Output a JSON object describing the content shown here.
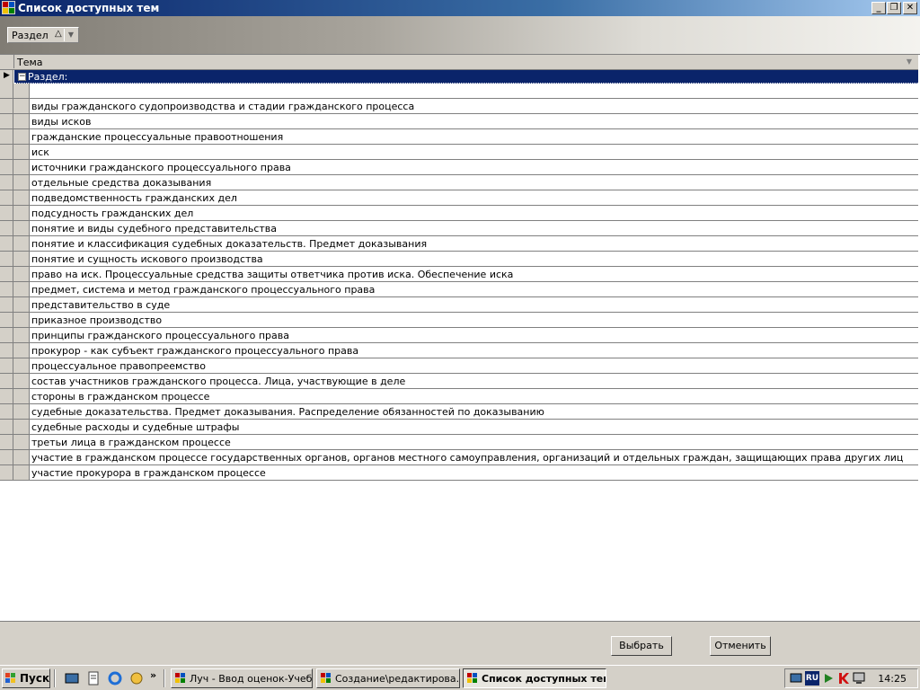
{
  "window": {
    "title": "Список доступных тем",
    "buttons": {
      "minimize": "_",
      "restore": "❐",
      "close": "✕"
    }
  },
  "group_panel": {
    "chip_label": "Раздел",
    "sort_glyph": "△",
    "dropdown_glyph": "▼"
  },
  "grid": {
    "column_header": "Тема",
    "column_dropdown_glyph": "▼",
    "group_row": {
      "selector_glyph": "▶",
      "toggle_glyph": "−",
      "label": "Раздел:"
    },
    "rows": [
      "",
      "виды гражданского судопроизводства и стадии гражданского процесса",
      "виды исков",
      "гражданские процессуальные правоотношения",
      "иск",
      "источники гражданского процессуального права",
      "отдельные средства доказывания",
      "подведомственность гражданских дел",
      "подсудность гражданских дел",
      "понятие и виды судебного представительства",
      "понятие и классификация судебных доказательств. Предмет доказывания",
      "понятие и сущность искового производства",
      "право на иск. Процессуальные средства защиты ответчика против иска. Обеспечение иска",
      "предмет, система и метод гражданского процессуального права",
      "представительство в суде",
      "приказное производство",
      "принципы гражданского процессуального права",
      "прокурор - как субъект гражданского процессуального права",
      "процессуальное правопреемство",
      "состав участников гражданского процесса. Лица, участвующие в деле",
      "стороны в гражданском процессе",
      "судебные доказательства. Предмет доказывания. Распределение обязанностей по доказыванию",
      "судебные расходы и судебные штрафы",
      "третьи лица в гражданском процессе",
      "участие в гражданском процессе государственных органов, органов местного самоуправления, организаций и отдельных граждан, защищающих права других лиц",
      "участие прокурора в гражданском процессе"
    ]
  },
  "footer": {
    "select_label": "Выбрать",
    "cancel_label": "Отменить"
  },
  "taskbar": {
    "start_label": "Пуск",
    "quicklaunch_more": "»",
    "tasks": [
      {
        "label": "Луч - Ввод оценок-Учеб...",
        "active": false
      },
      {
        "label": "Создание\\редактирова...",
        "active": false
      },
      {
        "label": "Список доступных тем",
        "active": true
      }
    ],
    "tray": {
      "language": "RU",
      "clock": "14:25"
    }
  },
  "colors": {
    "title_dark": "#0a246a",
    "title_light": "#a6caf0",
    "selection": "#0a246a",
    "face": "#d4d0c8"
  }
}
